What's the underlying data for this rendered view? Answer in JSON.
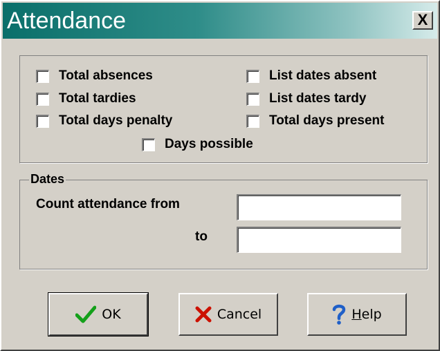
{
  "window": {
    "title": "Attendance",
    "close_label": "X"
  },
  "options": {
    "total_absences": {
      "label": "Total absences",
      "checked": false
    },
    "list_dates_absent": {
      "label": "List dates absent",
      "checked": false
    },
    "total_tardies": {
      "label": "Total tardies",
      "checked": false
    },
    "list_dates_tardy": {
      "label": "List dates tardy",
      "checked": false
    },
    "total_days_penalty": {
      "label": "Total days penalty",
      "checked": false
    },
    "total_days_present": {
      "label": "Total days present",
      "checked": false
    },
    "days_possible": {
      "label": "Days possible",
      "checked": false
    }
  },
  "dates": {
    "group_label": "Dates",
    "from_label": "Count attendance from",
    "from_value": "",
    "to_label": "to",
    "to_value": ""
  },
  "buttons": {
    "ok": {
      "label": "OK",
      "icon": "checkmark-icon",
      "color": "#14a01a"
    },
    "cancel": {
      "label": "Cancel",
      "icon": "x-icon",
      "color": "#cc1100"
    },
    "help": {
      "label_mnemonic": "H",
      "label_rest": "elp",
      "icon": "question-icon",
      "color": "#1f5fc8"
    }
  }
}
